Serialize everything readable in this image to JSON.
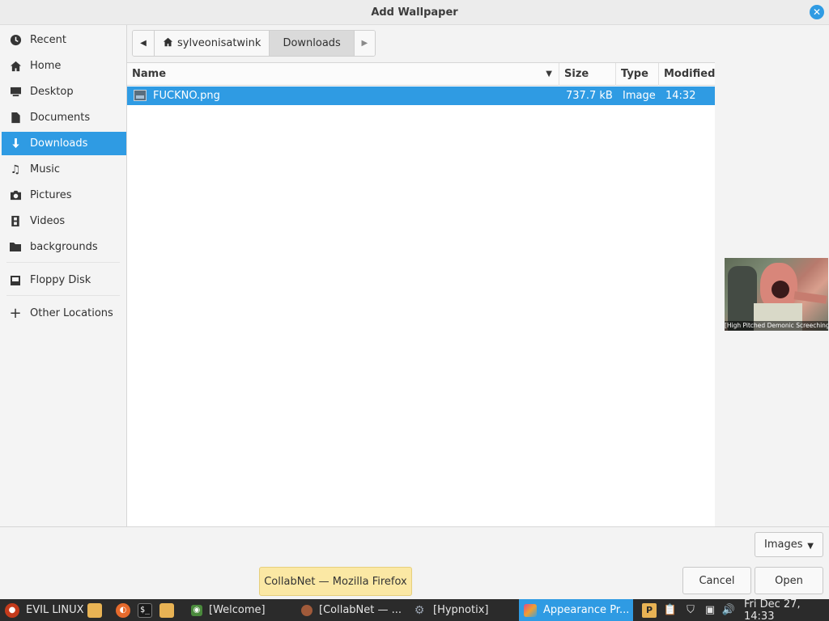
{
  "window": {
    "title": "Add Wallpaper"
  },
  "sidebar": {
    "items": [
      {
        "label": "Recent",
        "icon": "clock-icon"
      },
      {
        "label": "Home",
        "icon": "home-icon"
      },
      {
        "label": "Desktop",
        "icon": "desktop-icon"
      },
      {
        "label": "Documents",
        "icon": "document-icon"
      },
      {
        "label": "Downloads",
        "icon": "download-icon",
        "active": true
      },
      {
        "label": "Music",
        "icon": "music-icon"
      },
      {
        "label": "Pictures",
        "icon": "camera-icon"
      },
      {
        "label": "Videos",
        "icon": "film-icon"
      },
      {
        "label": "backgrounds",
        "icon": "folder-icon"
      },
      {
        "label": "Floppy Disk",
        "icon": "floppy-icon"
      },
      {
        "label": "Other Locations",
        "icon": "plus-icon"
      }
    ]
  },
  "pathbar": {
    "home": "sylveonisatwink",
    "current": "Downloads"
  },
  "filelist": {
    "columns": {
      "name": "Name",
      "size": "Size",
      "type": "Type",
      "modified": "Modified"
    },
    "rows": [
      {
        "name": "FUCKNO.png",
        "size": "737.7 kB",
        "type": "Image",
        "modified": "14:32"
      }
    ]
  },
  "preview": {
    "caption": "[High Pitched Demonic Screeching]"
  },
  "filter": {
    "selected": "Images"
  },
  "buttons": {
    "cancel": "Cancel",
    "open": "Open"
  },
  "tooltip": {
    "text": "CollabNet — Mozilla Firefox"
  },
  "taskbar": {
    "menu_label": "EVIL LINUX",
    "tasks": [
      {
        "label": "[Welcome]"
      },
      {
        "label": "[CollabNet — ..."
      },
      {
        "label": "[Hypnotix]"
      },
      {
        "label": "Appearance Pr...",
        "active": true
      }
    ],
    "clock": "Fri Dec 27, 14:33"
  },
  "colors": {
    "accent": "#2f9be3",
    "taskbar": "#2b2b2b",
    "tooltip": "#fbe8a4"
  }
}
